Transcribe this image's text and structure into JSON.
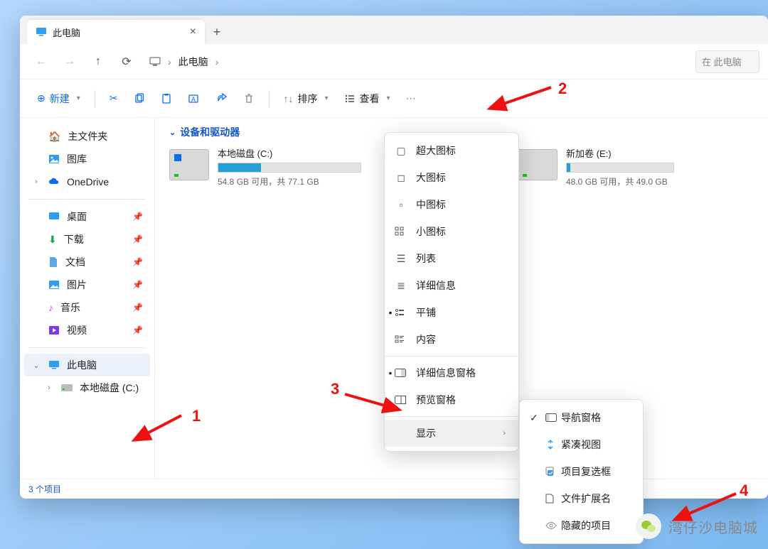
{
  "tab": {
    "title": "此电脑"
  },
  "breadcrumb": {
    "location": "此电脑"
  },
  "search": {
    "placeholder": "在 此电脑"
  },
  "toolbar": {
    "new": "新建",
    "sort": "排序",
    "view": "查看"
  },
  "sidebar": {
    "home": "主文件夹",
    "gallery": "图库",
    "onedrive": "OneDrive",
    "desktop": "桌面",
    "downloads": "下载",
    "documents": "文档",
    "pictures": "图片",
    "music": "音乐",
    "videos": "视频",
    "thispc": "此电脑",
    "driveC": "本地磁盘 (C:)"
  },
  "content": {
    "section": "设备和驱动器",
    "drives": [
      {
        "name": "本地磁盘 (C:)",
        "free": "54.8 GB 可用，共 77.1 GB",
        "fill": 30
      },
      {
        "name": "新加卷 (E:)",
        "free": "48.0 GB 可用，共 49.0 GB",
        "fill": 3
      }
    ]
  },
  "status": {
    "count": "3 个项目"
  },
  "viewMenu": {
    "xlarge": "超大图标",
    "large": "大图标",
    "medium": "中图标",
    "small": "小图标",
    "list": "列表",
    "details": "详细信息",
    "tiles": "平铺",
    "contentView": "内容",
    "detailsPane": "详细信息窗格",
    "previewPane": "预览窗格",
    "show": "显示"
  },
  "showMenu": {
    "navPane": "导航窗格",
    "compact": "紧凑视图",
    "checkboxes": "项目复选框",
    "extensions": "文件扩展名",
    "hidden": "隐藏的项目"
  },
  "annotations": {
    "n1": "1",
    "n2": "2",
    "n3": "3",
    "n4": "4"
  },
  "watermark": {
    "text": "湾仔沙电脑城"
  }
}
